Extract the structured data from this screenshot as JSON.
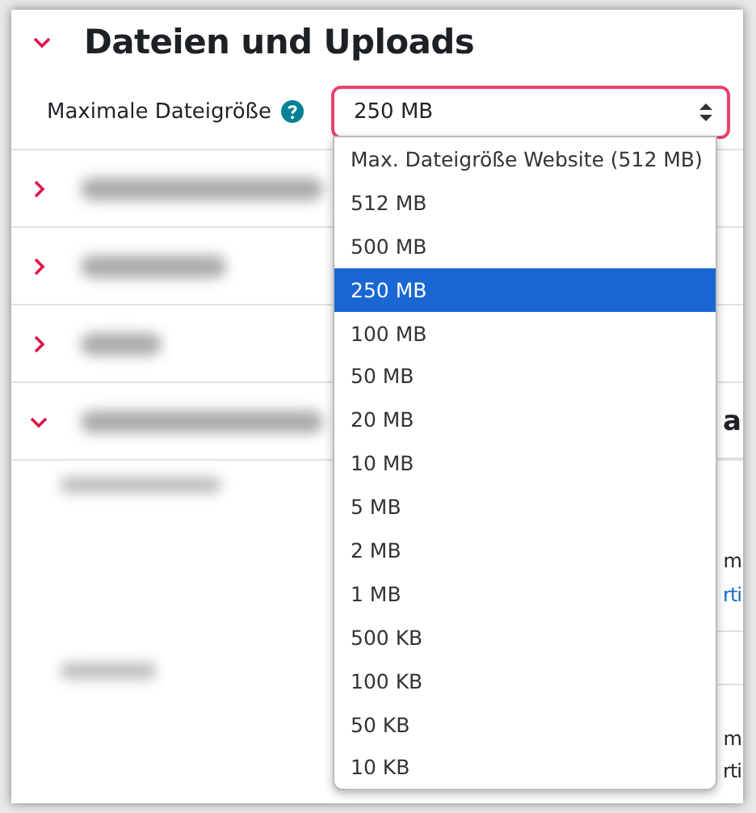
{
  "section": {
    "title": "Dateien und Uploads",
    "expanded": true
  },
  "field": {
    "label": "Maximale Dateigröße",
    "value": "250 MB"
  },
  "dropdown": {
    "options": [
      {
        "label": "Max. Dateigröße Website (512 MB)",
        "selected": false
      },
      {
        "label": "512 MB",
        "selected": false
      },
      {
        "label": "500 MB",
        "selected": false
      },
      {
        "label": "250 MB",
        "selected": true
      },
      {
        "label": "100 MB",
        "selected": false
      },
      {
        "label": "50 MB",
        "selected": false
      },
      {
        "label": "20 MB",
        "selected": false
      },
      {
        "label": "10 MB",
        "selected": false
      },
      {
        "label": "5 MB",
        "selected": false
      },
      {
        "label": "2 MB",
        "selected": false
      },
      {
        "label": "1 MB",
        "selected": false
      },
      {
        "label": "500 KB",
        "selected": false
      },
      {
        "label": "100 KB",
        "selected": false
      },
      {
        "label": "50 KB",
        "selected": false
      },
      {
        "label": "10 KB",
        "selected": false
      }
    ]
  },
  "other_sections": [
    {
      "expanded": false
    },
    {
      "expanded": false
    },
    {
      "expanded": false
    },
    {
      "expanded": true
    }
  ],
  "obscured_text_fragments": [
    "a",
    "m",
    "rti",
    "m",
    "rti"
  ]
}
